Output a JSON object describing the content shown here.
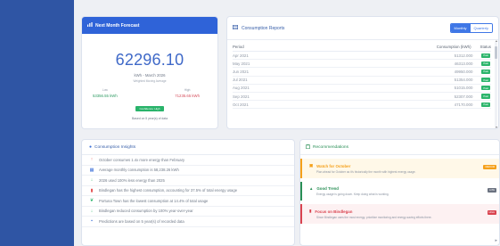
{
  "forecast": {
    "title": "Next Month Forecast",
    "value": "62296.10",
    "subtitle": "kWh - March 2026",
    "method": "Weighted Moving Average",
    "low_label": "Low",
    "low_value": "53356.55 kWh",
    "high_label": "High",
    "high_value": "71235.65 kWh",
    "confidence": "Confidence: High",
    "basis": "Based on 5 year(s) of data"
  },
  "reports": {
    "title": "Consumption Reports",
    "toggle": {
      "monthly": "Monthly",
      "quarterly": "Quarterly"
    },
    "columns": {
      "period": "Period",
      "consumption": "Consumption (kWh)",
      "status": "Status"
    },
    "rows": [
      {
        "period": "Apr 2021",
        "value": "51312.000",
        "status": "Past"
      },
      {
        "period": "May 2021",
        "value": "46313.000",
        "status": "Past"
      },
      {
        "period": "Jun 2021",
        "value": "49950.000",
        "status": "Past"
      },
      {
        "period": "Jul 2021",
        "value": "51354.000",
        "status": "Past"
      },
      {
        "period": "Aug 2021",
        "value": "51015.000",
        "status": "Past"
      },
      {
        "period": "Sep 2021",
        "value": "52307.000",
        "status": "Past"
      },
      {
        "period": "Oct 2021",
        "value": "47170.000",
        "status": "Past"
      }
    ]
  },
  "insights": {
    "title": "Consumption Insights",
    "items": [
      {
        "text": "October consumes 1.4x more energy than February",
        "icon": "arrow-up-icon",
        "color": "#e24c4c"
      },
      {
        "text": "Average monthly consumption is 58,238.26 kWh",
        "icon": "chart-icon",
        "color": "#3b6fd8"
      },
      {
        "text": "2026 used 100% less energy than 2025",
        "icon": "arrow-down-icon",
        "color": "#2cb56c"
      },
      {
        "text": "Bindlegan has the highest consumption, accounting for 37.5% of total energy usage",
        "icon": "building-icon",
        "color": "#e24c4c"
      },
      {
        "text": "Portuna Town has the lowest consumption at 14.4% of total usage",
        "icon": "leaf-icon",
        "color": "#2cb56c"
      },
      {
        "text": "Bindlegan reduced consumption by 100% year-over-year",
        "icon": "arrow-down-icon",
        "color": "#2cb56c"
      },
      {
        "text": "Predictions are based on 5 year(s) of recorded data",
        "icon": "info-icon",
        "color": "#3b6fd8"
      }
    ]
  },
  "recommendations": {
    "title": "Recommendations",
    "items": [
      {
        "title": "Watch for October",
        "desc": "Plan ahead for October as it's historically the month with highest energy usage.",
        "badge": "MEDIUM",
        "color": "#f5a01a",
        "bg": "#fff8e8",
        "icon": "calendar-icon"
      },
      {
        "title": "Good Trend",
        "desc": "Energy usage is going down. Keep doing what is working.",
        "badge": "LOW",
        "color": "#2a8f56",
        "bg": "#ffffff",
        "icon": "thumbs-up-icon"
      },
      {
        "title": "Focus on Bindlegan",
        "desc": "Since Bindlegan uses the most energy, prioritize monitoring and energy-saving efforts there.",
        "badge": "HIGH",
        "color": "#d9434f",
        "bg": "#fdf1f2",
        "icon": "building-icon"
      }
    ]
  }
}
